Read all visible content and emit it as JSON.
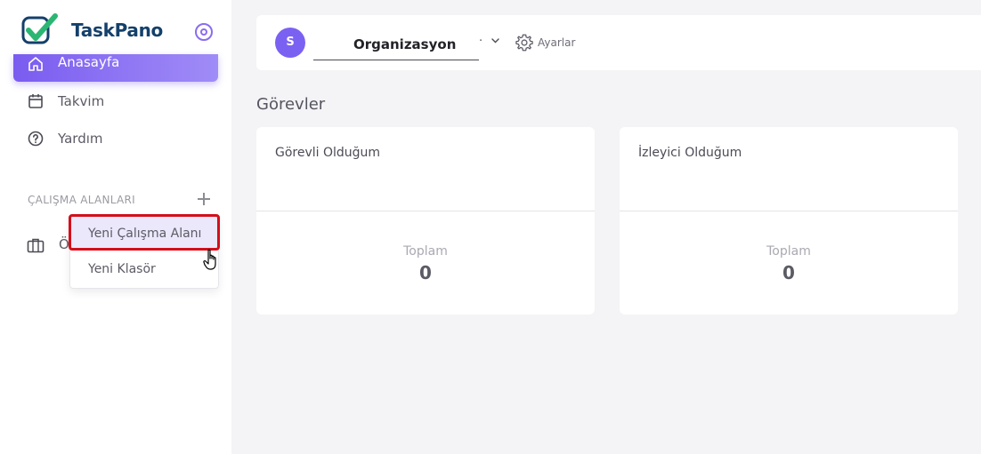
{
  "app": {
    "name": "TaskPano"
  },
  "sidebar": {
    "nav": [
      {
        "label": "Anasayfa",
        "icon": "home-icon"
      },
      {
        "label": "Takvim",
        "icon": "calendar-icon"
      },
      {
        "label": "Yardım",
        "icon": "help-icon"
      }
    ],
    "section_title": "ÇALIŞMA ALANLARI",
    "workspace_label": "Ö"
  },
  "menu": {
    "items": [
      {
        "label": "Yeni Çalışma Alanı"
      },
      {
        "label": "Yeni Klasör"
      }
    ]
  },
  "topbar": {
    "avatar_initial": "S",
    "organization": "Organizasyon",
    "dot": ".",
    "settings_label": "Ayarlar"
  },
  "main": {
    "title": "Görevler",
    "cards": [
      {
        "title": "Görevli Olduğum",
        "total_label": "Toplam",
        "total_value": "0"
      },
      {
        "title": "İzleyici Olduğum",
        "total_label": "Toplam",
        "total_value": "0"
      }
    ]
  },
  "colors": {
    "accent": "#7b61f2",
    "highlight_border": "#d40f1b",
    "brand_text": "#14406b"
  }
}
